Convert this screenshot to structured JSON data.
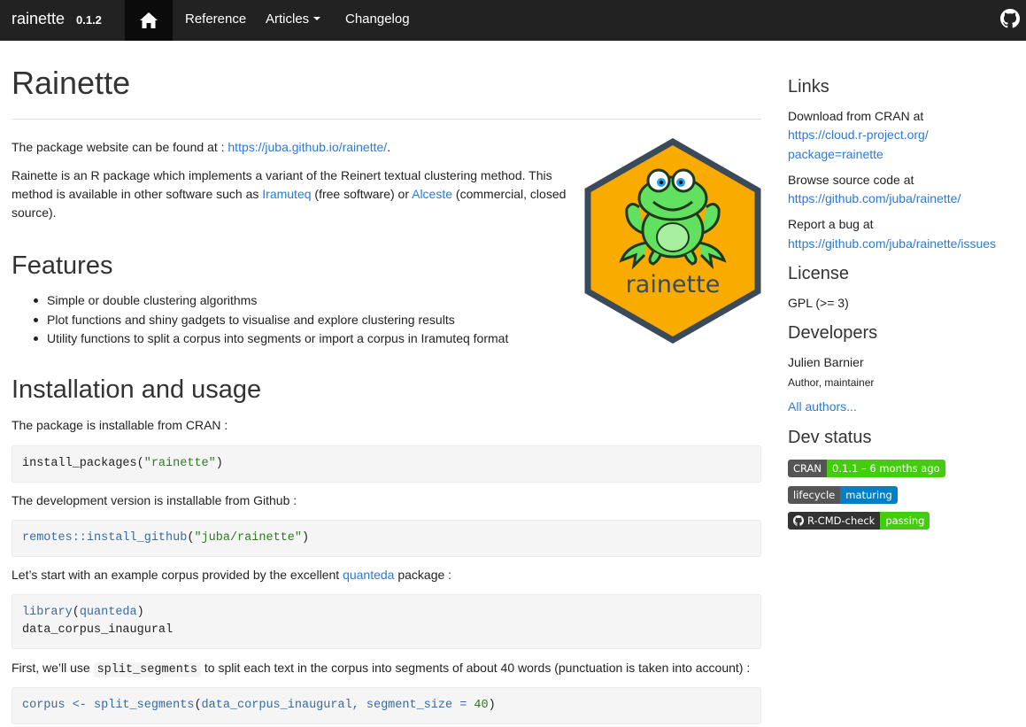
{
  "navbar": {
    "brand": "rainette",
    "version": "0.1.2",
    "items": [
      "Reference",
      "Articles",
      "Changelog"
    ]
  },
  "main": {
    "title": "Rainette",
    "intro_prefix": "The package website can be found at : ",
    "intro_link": "https://juba.github.io/rainette/",
    "intro_suffix": ".",
    "desc_1": "Rainette is an R package which implements a variant of the Reinert textual clustering method. This method is available in other software such as ",
    "desc_link_1": "Iramuteq",
    "desc_2": " (free software) or ",
    "desc_link_2": "Alceste",
    "desc_3": " (commercial, closed source).",
    "features_heading": "Features",
    "features": [
      "Simple or double clustering algorithms",
      "Plot functions and shiny gadgets to visualise and explore clustering results",
      "Utility functions to split a corpus into segments or import a corpus in Iramuteq format"
    ],
    "install_heading": "Installation and usage",
    "install_cran": "The package is installable from CRAN :",
    "code_1_fn": "install_packages",
    "code_1_arg": "\"rainette\"",
    "install_github": "The development version is installable from Github :",
    "code_2_fn": "remotes::install_github",
    "code_2_arg": "\"juba/rainette\"",
    "example_prefix": "Let’s start with an example corpus provided by the excellent ",
    "example_link": "quanteda",
    "example_suffix": " package :",
    "code_3_fn": "library",
    "code_3_arg": "quanteda",
    "code_3_line2": "data_corpus_inaugural",
    "split_prefix": "First, we’ll use ",
    "split_code": "split_segments",
    "split_suffix": " to split each text in the corpus into segments of about 40 words (punctuation is taken into account) :",
    "code_4_var": "corpus",
    "code_4_op": " <- ",
    "code_4_fn": "split_segments",
    "code_4_args": "data_corpus_inaugural, segment_size = ",
    "code_4_num": "40",
    "logo_text": "rainette"
  },
  "sidebar": {
    "links_heading": "Links",
    "cran_label": "Download from CRAN at",
    "cran_url_1": "https://cloud.r-project.org/",
    "cran_url_2": "package=rainette",
    "source_label": "Browse source code at",
    "source_url": "https://github.com/juba/rainette/",
    "bug_label": "Report a bug at",
    "bug_url": "https://github.com/juba/rainette/issues",
    "license_heading": "License",
    "license": "GPL (>= 3)",
    "developers_heading": "Developers",
    "developer_name": "Julien Barnier",
    "developer_role": "Author, maintainer",
    "all_authors": "All authors...",
    "devstatus_heading": "Dev status",
    "badges": [
      {
        "label": "CRAN",
        "value": "0.1.1 – 6 months ago",
        "color": "#4c1"
      },
      {
        "label": "lifecycle",
        "value": "maturing",
        "color": "#007ec6"
      },
      {
        "label": "R-CMD-check",
        "value": "passing",
        "color": "#4c1"
      }
    ]
  },
  "colors": {
    "navbar": "#222222",
    "link": "#2a7ad8",
    "logo_fill": "#f9ab00",
    "logo_border": "#3b4a5a",
    "frog": "#62e05f"
  }
}
